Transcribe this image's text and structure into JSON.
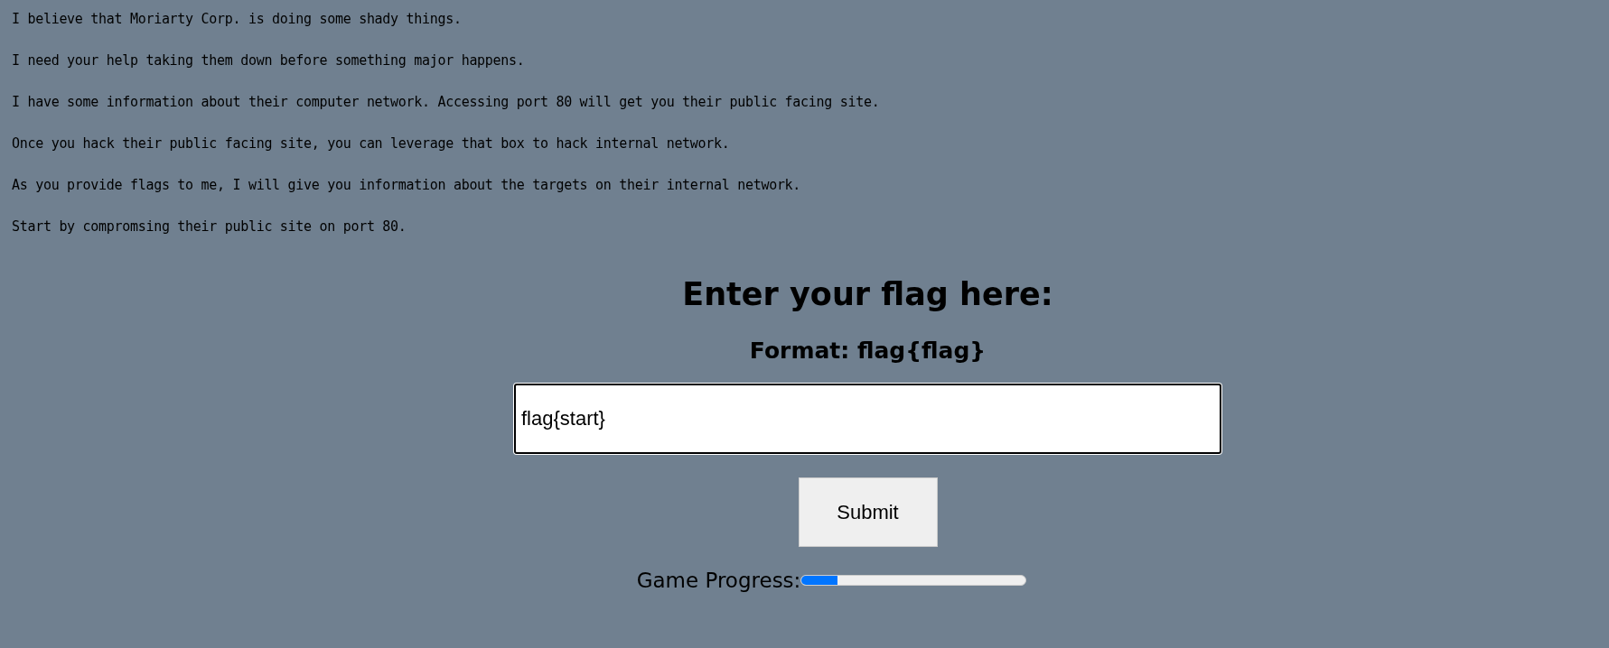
{
  "intro_paragraphs": [
    "I believe that Moriarty Corp. is doing some shady things.",
    "I need your help taking them down before something major happens.",
    "I have some information about their computer network. Accessing port 80 will get you their public facing site.",
    "Once you hack their public facing site, you can leverage that box to hack internal network.",
    "As you provide flags to me, I will give you information about the targets on their internal network.",
    "Start by compromsing their public site on port 80."
  ],
  "flag_form": {
    "heading": "Enter your flag here:",
    "format_hint": "Format: flag{flag}",
    "flag_input": {
      "value": "flag{start}"
    },
    "submit_button": "Submit"
  },
  "game_progress": {
    "label": "Game Progress:",
    "level": 0.16
  }
}
